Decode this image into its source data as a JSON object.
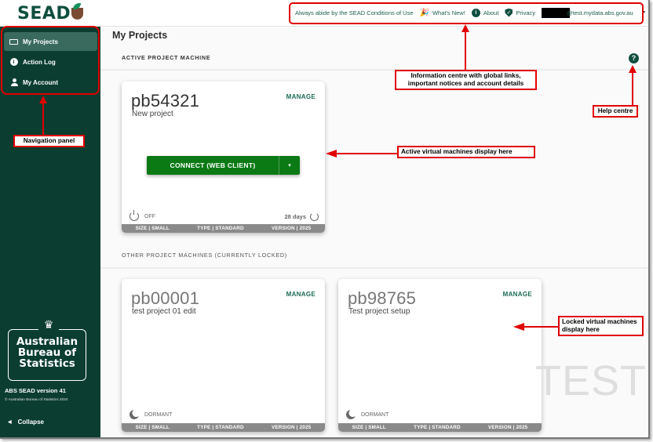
{
  "header": {
    "logo_text": "SEAD",
    "notice": "Always abide by the SEAD Conditions of Use",
    "links": [
      {
        "label": "What's New!",
        "icon": "party-popper-icon"
      },
      {
        "label": "About",
        "icon": "info-icon"
      },
      {
        "label": "Privacy",
        "icon": "shield-check-icon"
      }
    ],
    "account_email": "@test.mydata.abs.gov.au",
    "account_menu_icon": "▾"
  },
  "sidebar": {
    "items": [
      {
        "label": "My Projects",
        "icon": "laptop-icon",
        "active": true
      },
      {
        "label": "Action Log",
        "icon": "info-icon",
        "active": false
      },
      {
        "label": "My Account",
        "icon": "person-icon",
        "active": false
      }
    ],
    "org_logo_lines": [
      "Australian",
      "Bureau of",
      "Statistics"
    ],
    "version": "ABS SEAD version 41",
    "copyright": "© Australian Bureau of Statistics 2024",
    "collapse_label": "Collapse",
    "collapse_icon": "◀"
  },
  "main": {
    "title": "My Projects",
    "active_section_label": "ACTIVE PROJECT MACHINE",
    "other_section_label": "OTHER PROJECT MACHINES (CURRENTLY LOCKED)",
    "help_icon": "?",
    "active_card": {
      "id": "pb54321",
      "description": "New project",
      "manage_label": "MANAGE",
      "connect_label": "CONNECT (WEB CLIENT)",
      "connect_dropdown_icon": "▾",
      "power_status": "OFF",
      "days_remaining": "28 days",
      "footer": [
        "SIZE | SMALL",
        "TYPE | STANDARD",
        "VERSION | 2025"
      ]
    },
    "locked_cards": [
      {
        "id": "pb00001",
        "description": "test project 01 edit",
        "manage_label": "MANAGE",
        "status": "DORMANT",
        "footer": [
          "SIZE | SMALL",
          "TYPE | STANDARD",
          "VERSION | 2025"
        ]
      },
      {
        "id": "pb98765",
        "description": "Test project setup",
        "manage_label": "MANAGE",
        "status": "DORMANT",
        "footer": [
          "SIZE | SMALL",
          "TYPE | STANDARD",
          "VERSION | 2025"
        ]
      }
    ],
    "watermark": "TEST"
  },
  "annotations": {
    "navigation": "Navigation panel",
    "info_centre": "Information centre with global links, important notices and account details",
    "help": "Help centre",
    "active_vms": "Active virtual machines display here",
    "locked_vms": "Locked virtual machines display here"
  },
  "colors": {
    "brand_dark_green": "#0b3d31",
    "connect_green": "#0b7a15",
    "annotation_red": "#e00000"
  }
}
